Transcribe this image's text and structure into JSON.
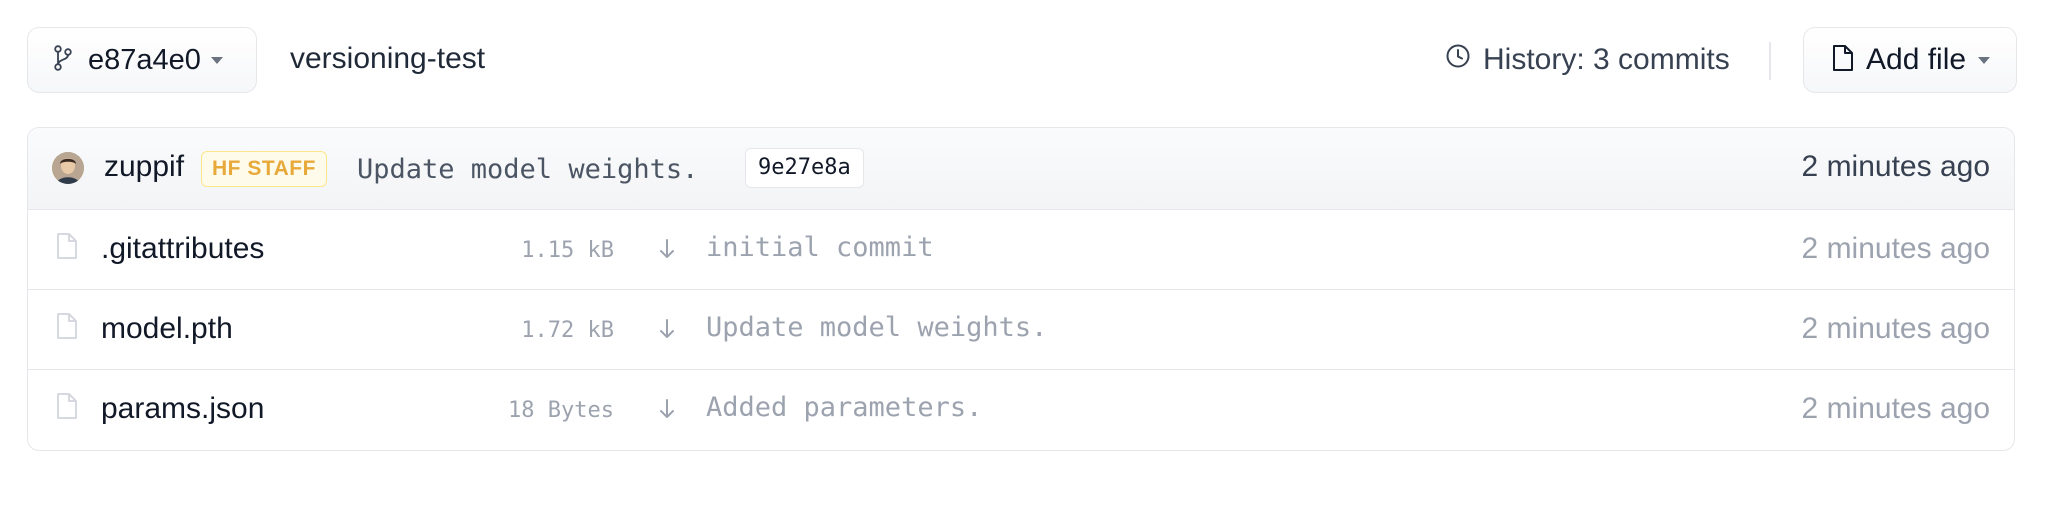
{
  "toolbar": {
    "branch_label": "e87a4e0",
    "repo_name": "versioning-test",
    "history_label": "History: 3 commits",
    "add_file_label": "Add file"
  },
  "last_commit": {
    "author": "zuppif",
    "badge": "HF STAFF",
    "message": "Update model weights.",
    "hash": "9e27e8a",
    "time": "2 minutes ago"
  },
  "files": [
    {
      "name": ".gitattributes",
      "size": "1.15 kB",
      "message": "initial commit",
      "time": "2 minutes ago"
    },
    {
      "name": "model.pth",
      "size": "1.72 kB",
      "message": "Update model weights.",
      "time": "2 minutes ago"
    },
    {
      "name": "params.json",
      "size": "18 Bytes",
      "message": "Added parameters.",
      "time": "2 minutes ago"
    }
  ],
  "icons": {
    "branch": "git-branch-icon",
    "history": "clock-icon",
    "add_file": "file-icon",
    "file": "file-icon",
    "download": "download-arrow-icon"
  },
  "colors": {
    "badge_text": "#e8a93b",
    "badge_bg": "#fffbeb",
    "muted_text": "#9ca3af",
    "border": "#e5e7eb"
  }
}
